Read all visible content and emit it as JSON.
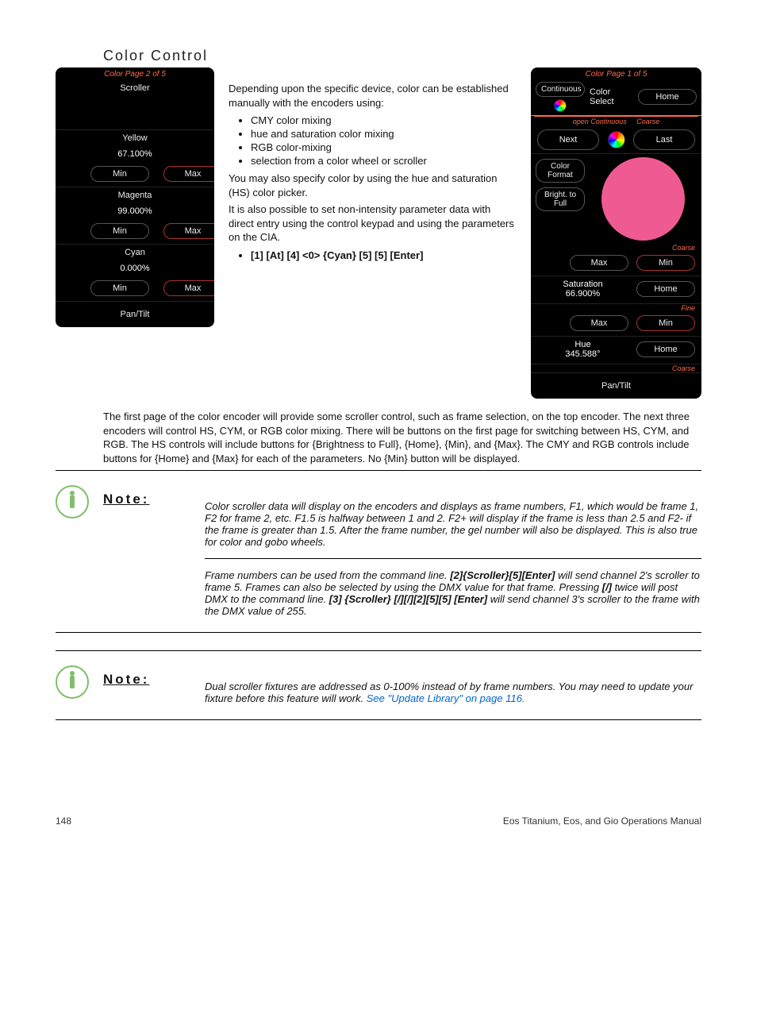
{
  "section_title": "Color Control",
  "intro_p1": "Depending upon the specific device, color can be established manually with the encoders using:",
  "bullets": [
    "CMY color mixing",
    "hue and saturation color mixing",
    "RGB color-mixing",
    "selection from a color wheel or scroller"
  ],
  "intro_p2": "You may also specify color by using the hue and saturation (HS) color picker.",
  "intro_p3": "It is also possible to set non-intensity parameter data with direct entry using the control keypad and using the parameters on the CIA.",
  "example": "[1] [At] [4] <0> {Cyan} [5] [5] [Enter]",
  "body_long": "The first page of the color encoder will provide some scroller control, such as frame selection, on the top encoder. The next three encoders will control HS, CYM, or RGB color mixing. There will be buttons on the first page for switching between HS, CYM, and RGB. The HS controls will include buttons for {Brightness to Full}, {Home}, {Min}, and {Max}. The CMY and RGB controls include buttons for {Home} and {Max} for each of the parameters. No {Min} button will be displayed.",
  "panelL": {
    "page": "Color Page 2 of 5",
    "scroller": "Scroller",
    "rows": [
      {
        "name": "Yellow",
        "value": "67.100%"
      },
      {
        "name": "Magenta",
        "value": "99.000%"
      },
      {
        "name": "Cyan",
        "value": "0.000%"
      }
    ],
    "min": "Min",
    "max": "Max",
    "pantilt": "Pan/Tilt"
  },
  "panelR": {
    "page": "Color Page 1 of 5",
    "continuous": "Continuous",
    "color_select": "Color Select",
    "home": "Home",
    "open_continuous": "open Continuous",
    "coarse": "Coarse",
    "fine": "Fine",
    "next": "Next",
    "last": "Last",
    "color_format": "Color\nFormat",
    "bright_full": "Bright. to\nFull",
    "max": "Max",
    "min": "Min",
    "sat_label": "Saturation",
    "sat_val": "66.900%",
    "hue_label": "Hue",
    "hue_val": "345.588°",
    "pantilt": "Pan/Tilt"
  },
  "notes": [
    {
      "label": "Note:",
      "paras": [
        "Color scroller data will display on the encoders and displays as frame numbers, F1, which would be frame 1, F2 for frame 2, etc. F1.5 is halfway between 1 and 2. F2+ will display if the frame is less than 2.5 and F2- if the frame is greater than 1.5. After the frame number, the gel number will also be displayed. This is also true for color and gobo wheels.",
        "Frame numbers can be used from the command line. [2]{Scroller}[5][Enter] will send channel 2's scroller to frame 5. Frames can also be selected by using the DMX value for that frame. Pressing [/] twice will post DMX to the command line. [3] {Scroller} [/][/][2][5][5] [Enter] will send channel 3's scroller to the frame with the DMX value of 255."
      ]
    },
    {
      "label": "Note:",
      "paras": [
        "Dual scroller fixtures are addressed as 0-100% instead of by frame numbers. You may need to update your fixture before this feature will work. See \"Update Library\" on page 116."
      ]
    }
  ],
  "footer": {
    "page": "148",
    "manual": "Eos Titanium, Eos, and Gio Operations Manual"
  }
}
